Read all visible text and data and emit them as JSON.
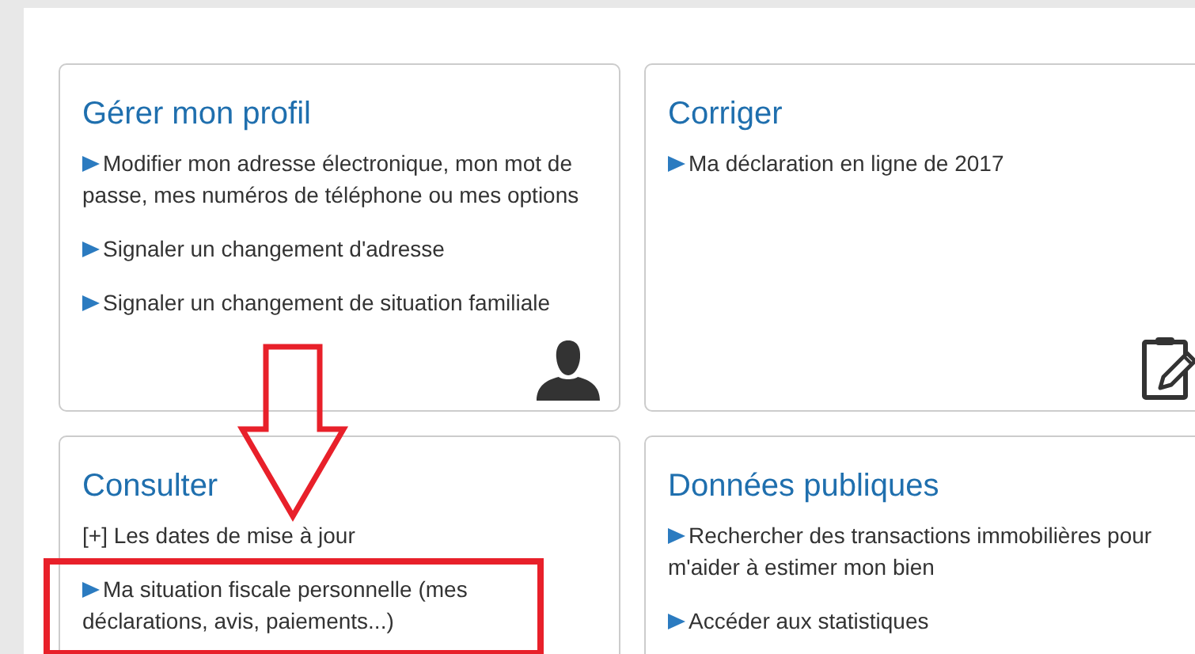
{
  "cards": [
    {
      "title": "Gérer mon profil",
      "items": [
        {
          "kind": "link",
          "text": "Modifier mon adresse électronique, mon mot de passe, mes numéros de téléphone ou mes options"
        },
        {
          "kind": "link",
          "text": "Signaler un changement d'adresse"
        },
        {
          "kind": "link",
          "text": "Signaler un changement de situation familiale"
        }
      ]
    },
    {
      "title": "Corriger",
      "items": [
        {
          "kind": "link",
          "text": "Ma déclaration en ligne de 2017"
        }
      ]
    },
    {
      "title": "Consulter",
      "items": [
        {
          "kind": "toggle",
          "text": "[+] Les dates de mise à jour"
        },
        {
          "kind": "link",
          "text": "Ma situation fiscale personnelle (mes déclarations, avis, paiements...)"
        }
      ]
    },
    {
      "title": "Données publiques",
      "items": [
        {
          "kind": "link",
          "text": "Rechercher des transactions immobilières pour m'aider à estimer mon bien"
        },
        {
          "kind": "link",
          "text": "Accéder aux statistiques"
        }
      ]
    }
  ]
}
